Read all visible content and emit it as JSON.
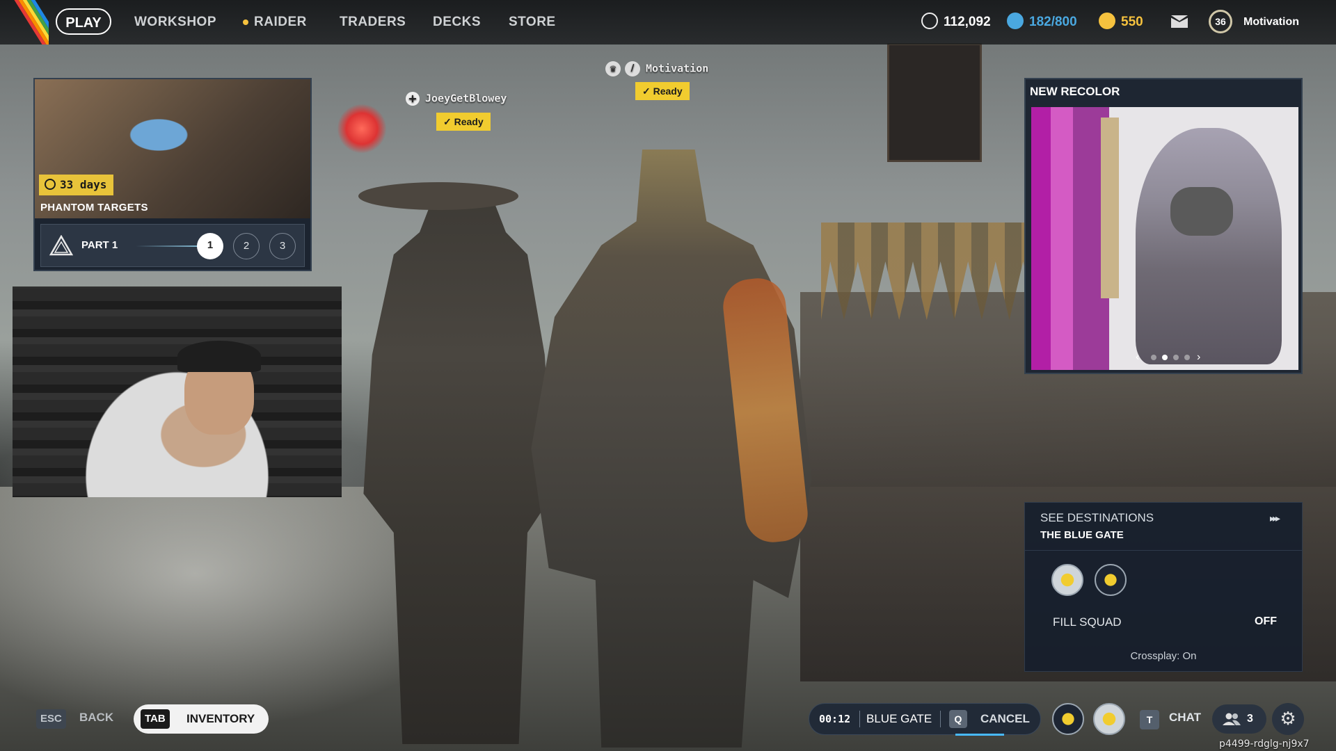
{
  "nav": {
    "play": "PLAY",
    "workshop": "WORKSHOP",
    "raider": "RAIDER",
    "traders": "TRADERS",
    "decks": "DECKS",
    "store": "STORE"
  },
  "resources": {
    "coins": "112,092",
    "storage": "182/800",
    "tokens": "550",
    "accent_storage": "#4aa8e0",
    "accent_tokens": "#f6c23e"
  },
  "profile": {
    "level": "36",
    "name": "Motivation"
  },
  "event_card": {
    "timer": "33 days",
    "title": "PHANTOM TARGETS",
    "part_label": "PART 1",
    "steps": [
      "1",
      "2",
      "3"
    ],
    "active_step": 1
  },
  "party": {
    "player1": {
      "name": "JoeyGetBlowey",
      "status": "Ready"
    },
    "player2": {
      "name": "Motivation",
      "status": "Ready"
    }
  },
  "recolor_card": {
    "title": "NEW RECOLOR",
    "slides": 4,
    "active_slide": 2
  },
  "destinations": {
    "title": "SEE DESTINATIONS",
    "current": "THE BLUE GATE",
    "fill_squad_label": "FILL SQUAD",
    "fill_squad_value": "OFF",
    "crossplay": "Crossplay: On"
  },
  "bottom": {
    "esc_key": "ESC",
    "back_label": "BACK",
    "tab_key": "TAB",
    "inventory_label": "INVENTORY",
    "queue_time": "00:12",
    "queue_dest": "BLUE GATE",
    "cancel_key": "Q",
    "cancel_label": "CANCEL",
    "chat_key": "T",
    "chat_label": "CHAT",
    "squad_count": "3",
    "session_id": "p4499-rdglg-nj9x7"
  }
}
